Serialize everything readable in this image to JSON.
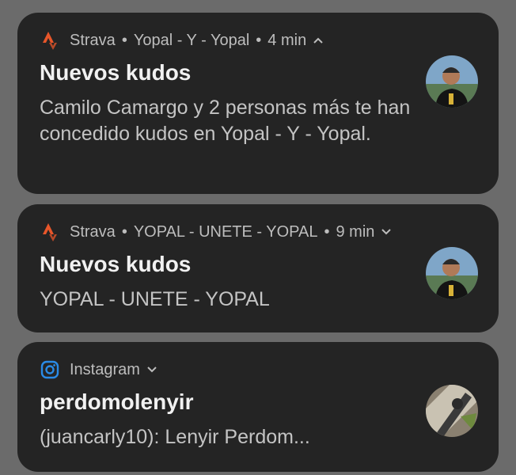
{
  "notifications": [
    {
      "app": "Strava",
      "subtext": "Yopal - Y - Yopal",
      "time": "4 min",
      "expanded": true,
      "title": "Nuevos kudos",
      "body": "Camilo Camargo y 2 personas más te han concedido kudos en Yopal - Y - Yopal.",
      "icon": "strava-icon",
      "avatar": "profile-photo"
    },
    {
      "app": "Strava",
      "subtext": "YOPAL - UNETE - YOPAL",
      "time": "9 min",
      "expanded": false,
      "title": "Nuevos kudos",
      "body": "YOPAL - UNETE - YOPAL",
      "icon": "strava-icon",
      "avatar": "profile-photo"
    },
    {
      "app": "Instagram",
      "subtext": "",
      "time": "",
      "expanded": false,
      "title": "perdomolenyir",
      "body": "(juancarly10): Lenyir Perdom...",
      "icon": "instagram-icon",
      "avatar": "post-thumbnail"
    }
  ],
  "header_separator": "•",
  "colors": {
    "card_background": "#242424",
    "screen_background": "#6b6b6b",
    "strava_orange": "#e8562a",
    "instagram_blue": "#2a8be6"
  }
}
